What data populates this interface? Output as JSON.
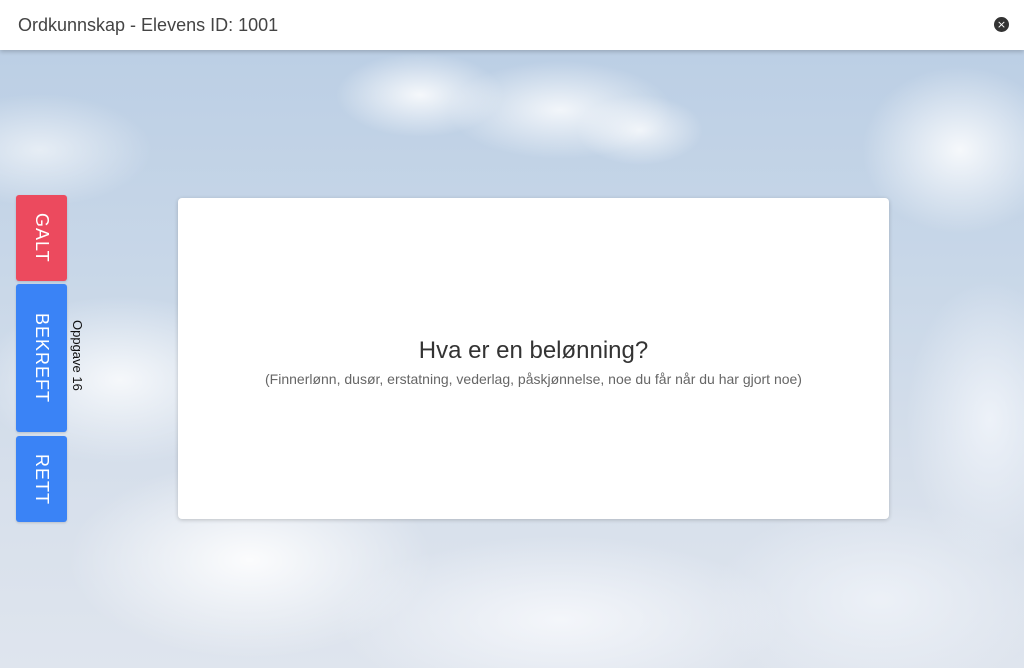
{
  "header": {
    "title": "Ordkunnskap - Elevens ID: 1001",
    "close_icon": "close-icon",
    "close_glyph": "×"
  },
  "sidebar": {
    "wrong_label": "GALT",
    "confirm_label": "BEKREFT",
    "right_label": "RETT",
    "task_label": "Oppgave 16"
  },
  "card": {
    "question": "Hva er en belønning?",
    "hint": "(Finnerlønn, dusør, erstatning, vederlag, påskjønnelse, noe du får når du har gjort noe)"
  },
  "colors": {
    "wrong": "#ec4a5e",
    "primary": "#3a83f6"
  }
}
